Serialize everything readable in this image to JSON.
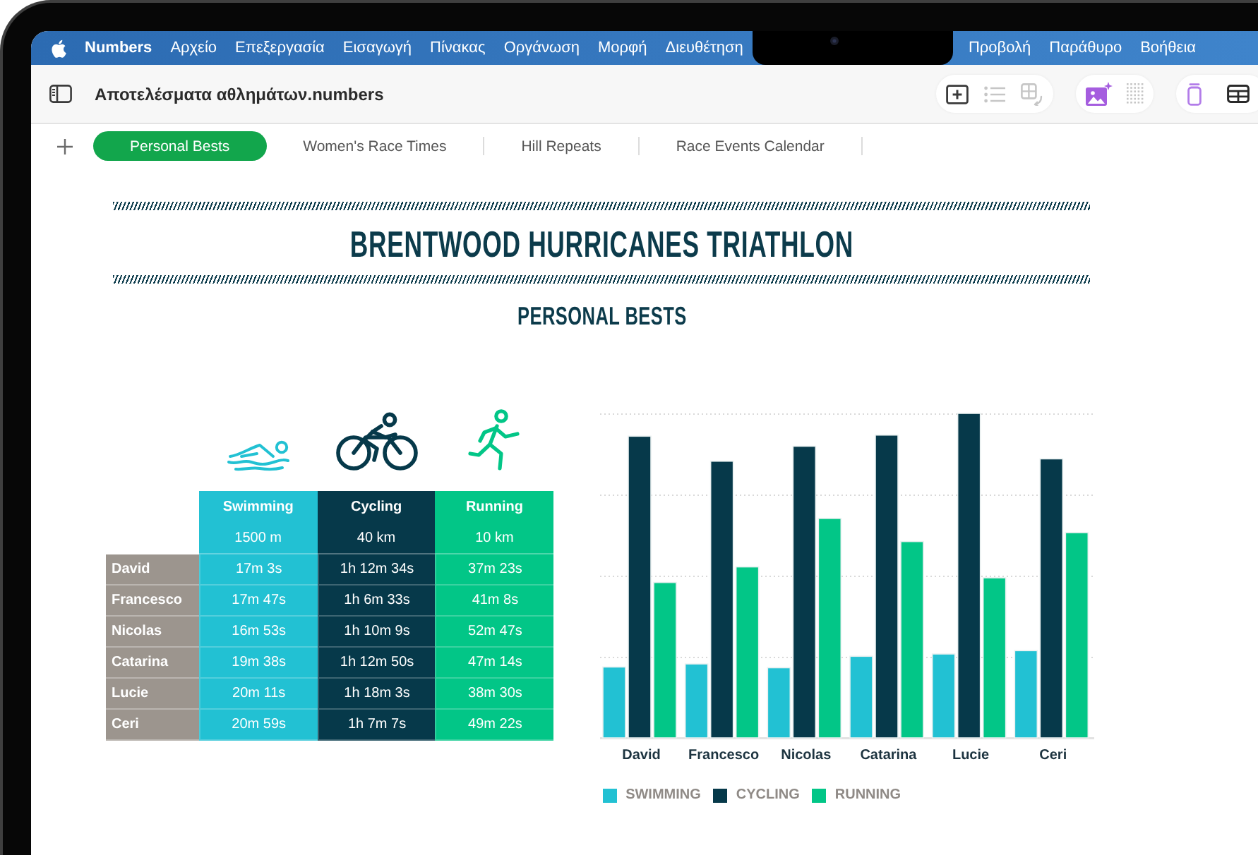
{
  "menu_bar": {
    "app_name": "Numbers",
    "menus": [
      "Αρχείο",
      "Επεξεργασία",
      "Εισαγωγή",
      "Πίνακας",
      "Οργάνωση",
      "Μορφή",
      "Διευθέτηση"
    ],
    "right_menus": [
      "Προβολή",
      "Παράθυρο",
      "Βοήθεια"
    ]
  },
  "toolbar": {
    "title": "Αποτελέσματα αθλημάτων.numbers",
    "groups": [
      {
        "tools": [
          {
            "kind": "insert",
            "disabled": false
          },
          {
            "kind": "list",
            "disabled": true
          },
          {
            "kind": "table_arrow",
            "disabled": true
          }
        ]
      },
      {
        "tools": [
          {
            "kind": "media",
            "disabled": false
          },
          {
            "kind": "grid",
            "disabled": true
          }
        ]
      },
      {
        "tools": [
          {
            "kind": "shape",
            "disabled": false
          },
          {
            "kind": "table",
            "disabled": false
          }
        ]
      }
    ]
  },
  "sheet_tabs": [
    {
      "label": "Personal Bests",
      "selected": true
    },
    {
      "label": "Women's Race Times",
      "selected": false
    },
    {
      "label": "Hill Repeats",
      "selected": false
    },
    {
      "label": "Race Events Calendar",
      "selected": false
    }
  ],
  "document": {
    "title": "BRENTWOOD HURRICANES TRIATHLON",
    "subtitle": "PERSONAL BESTS"
  },
  "table": {
    "columns": [
      {
        "kind": "swimmer",
        "name": "Swimming",
        "distance": "1500 m",
        "color": "#22c1d3"
      },
      {
        "kind": "cyclist",
        "name": "Cycling",
        "distance": "40 km",
        "color": "#06394a"
      },
      {
        "kind": "runner",
        "name": "Running",
        "distance": "10 km",
        "color": "#02c687"
      }
    ],
    "rows": [
      {
        "name": "David",
        "times": [
          "17m 3s",
          "1h 12m 34s",
          "37m 23s"
        ]
      },
      {
        "name": "Francesco",
        "times": [
          "17m 47s",
          "1h 6m 33s",
          "41m 8s"
        ]
      },
      {
        "name": "Nicolas",
        "times": [
          "16m 53s",
          "1h 10m 9s",
          "52m 47s"
        ]
      },
      {
        "name": "Catarina",
        "times": [
          "19m 38s",
          "1h 12m 50s",
          "47m 14s"
        ]
      },
      {
        "name": "Lucie",
        "times": [
          "20m 11s",
          "1h 18m 3s",
          "38m 30s"
        ]
      },
      {
        "name": "Ceri",
        "times": [
          "20m 59s",
          "1h 7m 7s",
          "49m 22s"
        ]
      }
    ]
  },
  "chart": {
    "categories": [
      "David",
      "Francesco",
      "Nicolas",
      "Catarina",
      "Lucie",
      "Ceri"
    ],
    "legend": [
      {
        "label": "SWIMMING",
        "color": "#22c1d3"
      },
      {
        "label": "CYCLING",
        "color": "#06394a"
      },
      {
        "label": "RUNNING",
        "color": "#02c687"
      }
    ]
  }
}
